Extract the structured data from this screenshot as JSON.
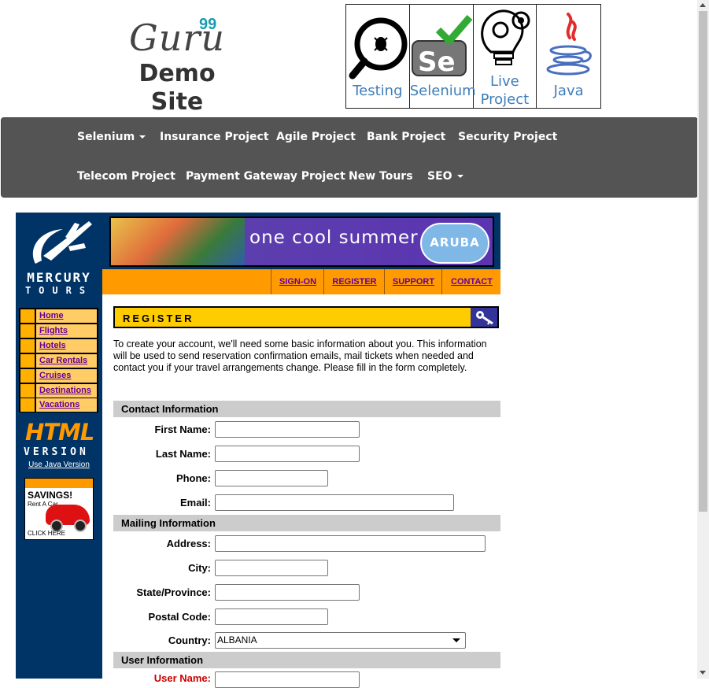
{
  "header": {
    "logo_brand": "Guru",
    "logo_superscript": "99",
    "logo_subtitle": "Demo Site",
    "courses": [
      {
        "label": "Testing",
        "icon": "magnifier-bug-icon"
      },
      {
        "label": "Selenium",
        "icon": "selenium-checkmark-icon"
      },
      {
        "label_line1": "Live",
        "label_line2": "Project",
        "icon": "lightbulb-gears-icon"
      },
      {
        "label": "Java",
        "icon": "java-cup-icon"
      }
    ]
  },
  "navbar": {
    "items": [
      "Selenium",
      "Insurance Project",
      "Agile Project",
      "Bank Project",
      "Security Project",
      "Telecom Project",
      "Payment Gateway Project",
      "New Tours",
      "SEO"
    ]
  },
  "mercury": {
    "logo_line1": "MERCURY",
    "logo_line2": "TOURS",
    "banner_text": "one cool summer",
    "banner_badge": "ARUBA",
    "top_links": [
      "SIGN-ON",
      "REGISTER",
      "SUPPORT",
      "CONTACT"
    ],
    "side_links": [
      "Home",
      "Flights",
      "Hotels",
      "Car Rentals",
      "Cruises",
      "Destinations",
      "Vacations"
    ],
    "html_version_line1": "HTML",
    "html_version_line2": "VERSION",
    "java_version_link": "Use Java Version",
    "ad_title": "SAVINGS!",
    "ad_subtitle": "Rent A Car",
    "ad_cta": "CLICK HERE"
  },
  "register": {
    "title": "REGISTER",
    "intro": "To create your account, we'll need some basic information about you. This information will be used to send reservation confirmation emails, mail tickets when needed and contact you if your travel arrangements change. Please fill in the form completely.",
    "sections": {
      "contact": "Contact Information",
      "mailing": "Mailing Information",
      "user": "User Information"
    },
    "fields": {
      "first_name": "First Name:",
      "last_name": "Last Name:",
      "phone": "Phone:",
      "email": "Email:",
      "address": "Address:",
      "city": "City:",
      "state": "State/Province:",
      "postal": "Postal Code:",
      "country": "Country:",
      "username": "User Name:"
    },
    "country_value": "ALBANIA"
  },
  "colors": {
    "navbar_bg": "#545454",
    "mercury_blue": "#003366",
    "orange": "#ff9a00",
    "register_yellow": "#ffcc00",
    "section_grey": "#cccccc",
    "link_purple": "#660099",
    "course_blue": "#3e7eb8"
  }
}
